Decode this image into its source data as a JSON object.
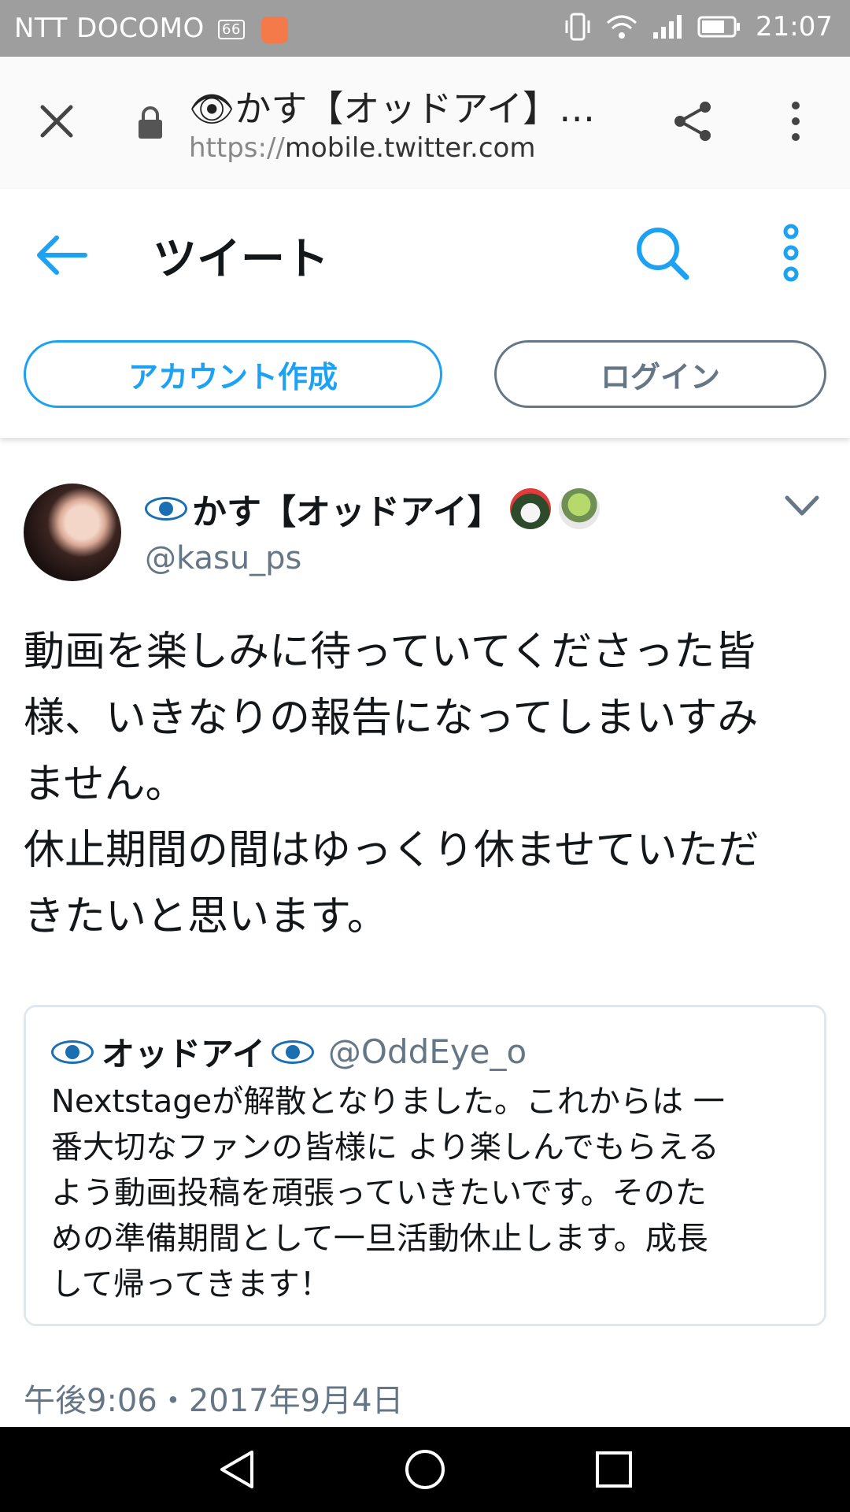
{
  "status_bar": {
    "carrier": "NTT DOCOMO",
    "badge": "66",
    "time": "21:07"
  },
  "browser": {
    "page_title": "👁かす【オッドアイ】…",
    "url_scheme": "https://",
    "url_host": "mobile.twitter.com"
  },
  "header": {
    "title": "ツイート",
    "signup_label": "アカウント作成",
    "login_label": "ログイン",
    "accent_color": "#1da1f2"
  },
  "tweet": {
    "author_name": "かす【オッドアイ】",
    "author_handle": "@kasu_ps",
    "text_lines": [
      "動画を楽しみに待っていてくださった皆",
      "様、いきなりの報告になってしまいすみ",
      "ません。",
      "休止期間の間はゆっくり休ませていただ",
      "きたいと思います。"
    ],
    "quote": {
      "name": "オッドアイ",
      "handle": "@OddEye_o",
      "text_lines": [
        "Nextstageが解散となりました。これからは 一",
        "番大切なファンの皆様に より楽しんでもらえる",
        "よう動画投稿を頑張っていきたいです。そのた",
        "めの準備期間として一旦活動休止します。成長",
        "して帰ってきます！"
      ]
    },
    "timestamp": "午後9:06・2017年9月4日"
  }
}
